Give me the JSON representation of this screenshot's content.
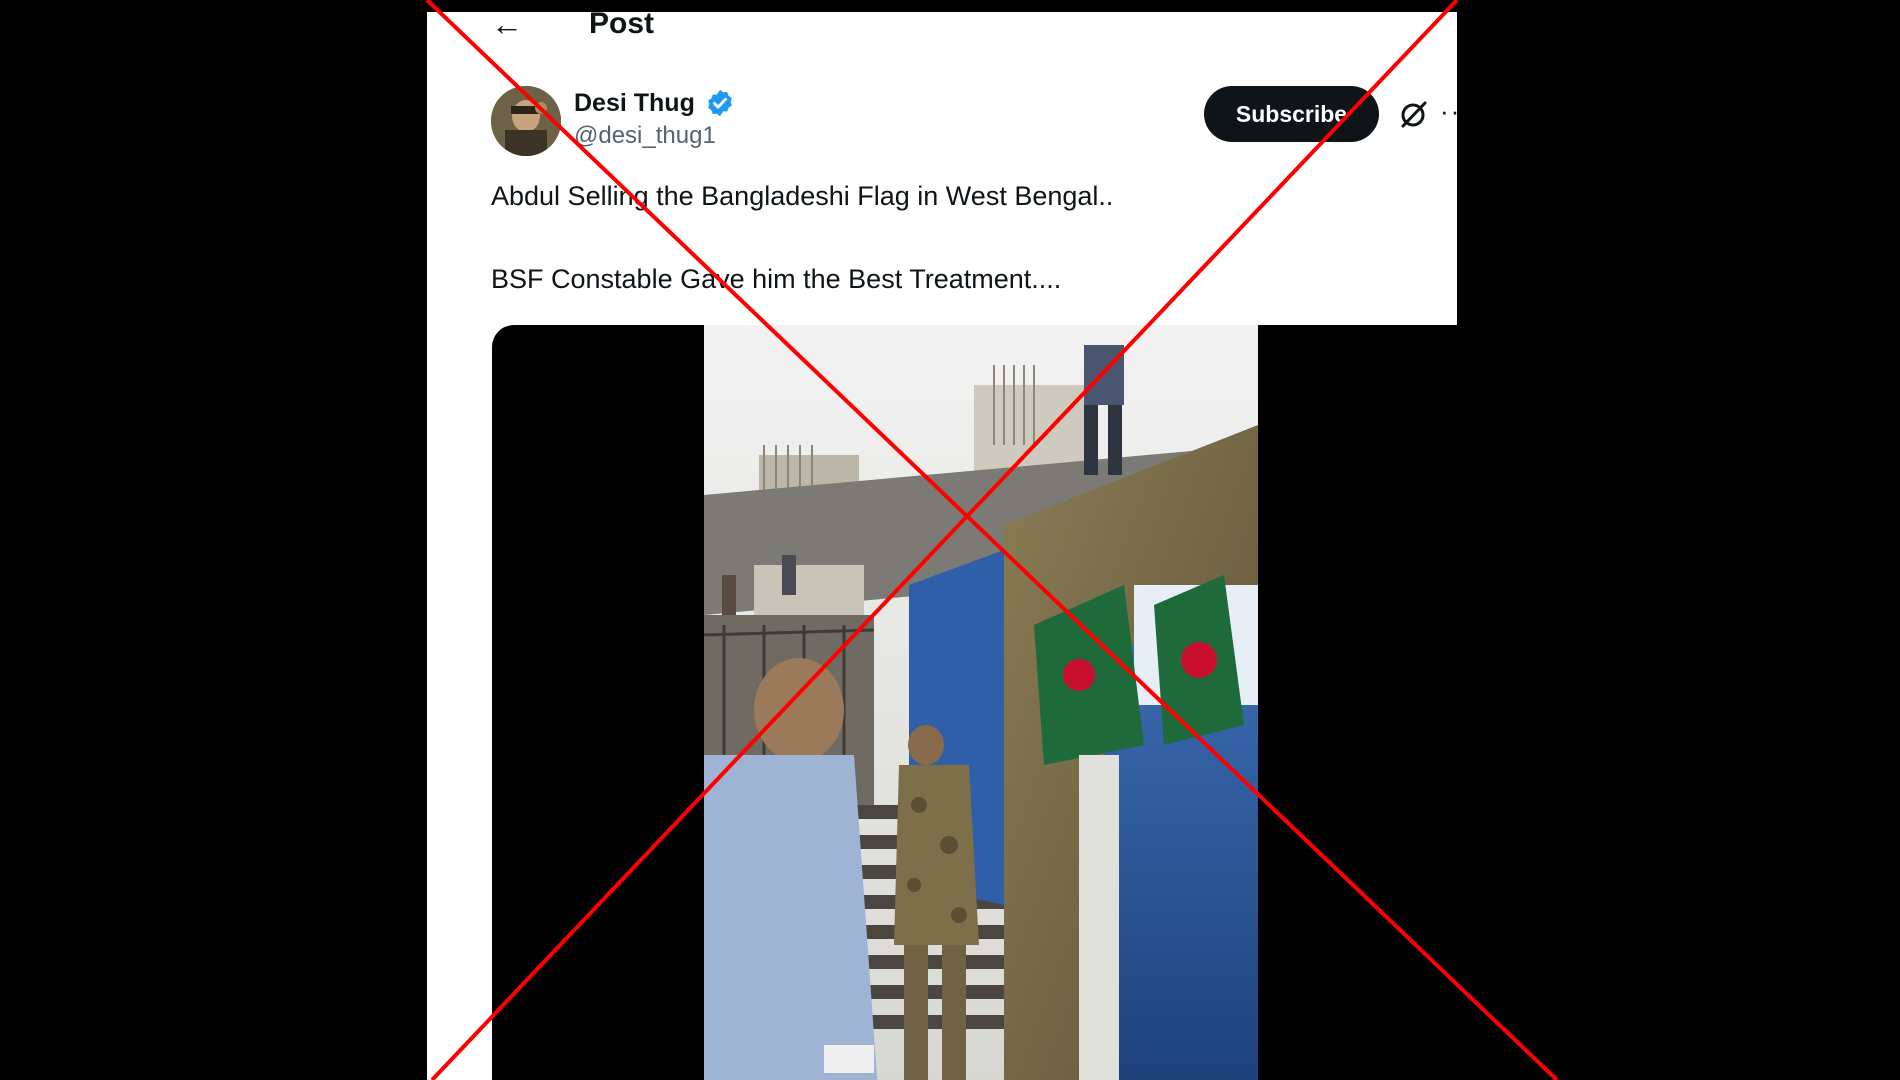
{
  "header": {
    "back_icon": "arrow-left-icon",
    "title": "Post"
  },
  "author": {
    "display_name": "Desi Thug",
    "handle": "@desi_thug1",
    "verified": true,
    "verified_color": "#1d9bf0"
  },
  "actions": {
    "subscribe_label": "Subscribe",
    "grok_icon": "grok-icon",
    "more_icon": "more-options-icon"
  },
  "tweet": {
    "line_1": "Abdul Selling the Bangladeshi Flag in West Bengal..",
    "line_2": "BSF Constable Gave him the Best Treatment...."
  },
  "media": {
    "type": "video",
    "icon": "video-thumbnail"
  },
  "overlay": {
    "mark": "red-x-cross-icon",
    "color": "#ff0000"
  },
  "colors": {
    "text_primary": "#0f1419",
    "text_secondary": "#536471",
    "button_bg": "#0f1419",
    "page_bg": "#000000",
    "panel_bg": "#ffffff"
  }
}
